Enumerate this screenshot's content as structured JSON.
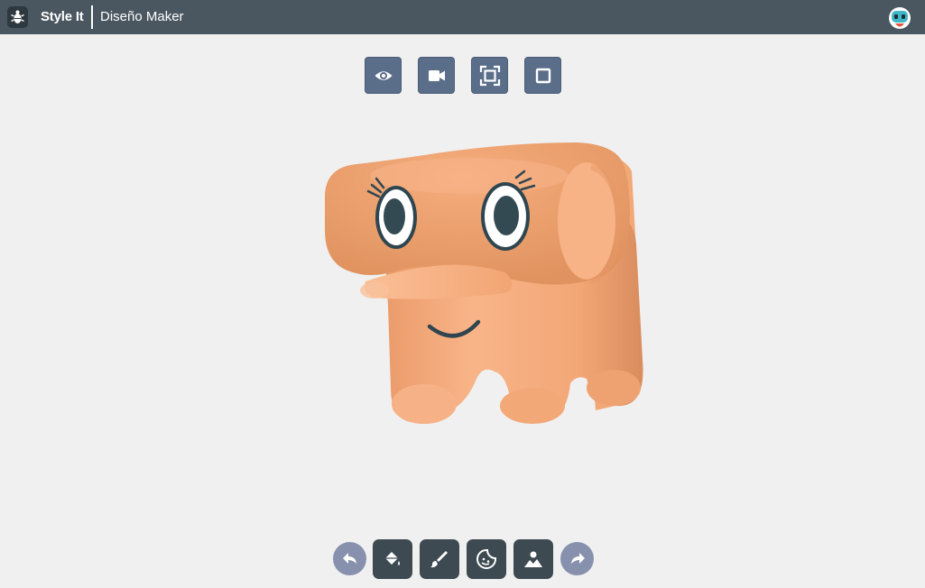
{
  "header": {
    "brand": "Style It",
    "app_title": "Diseño Maker",
    "bg_color": "#4a5761"
  },
  "view_controls": [
    {
      "name": "preview",
      "icon": "eye-icon"
    },
    {
      "name": "camera",
      "icon": "video-camera-icon"
    },
    {
      "name": "fit-view",
      "icon": "fit-frame-icon"
    },
    {
      "name": "stop",
      "icon": "square-icon"
    }
  ],
  "toolbar": [
    {
      "name": "undo",
      "icon": "undo-icon"
    },
    {
      "name": "fill",
      "icon": "paint-bucket-icon"
    },
    {
      "name": "brush",
      "icon": "brush-icon"
    },
    {
      "name": "sticker",
      "icon": "sticker-icon"
    },
    {
      "name": "image",
      "icon": "image-icon"
    },
    {
      "name": "redo",
      "icon": "redo-icon"
    }
  ],
  "colors": {
    "background": "#f0f0f0",
    "view_button": "#5a6e8a",
    "tool_button": "#3e4a52",
    "round_button": "#8791ad",
    "character_skin": "#f2a878"
  }
}
